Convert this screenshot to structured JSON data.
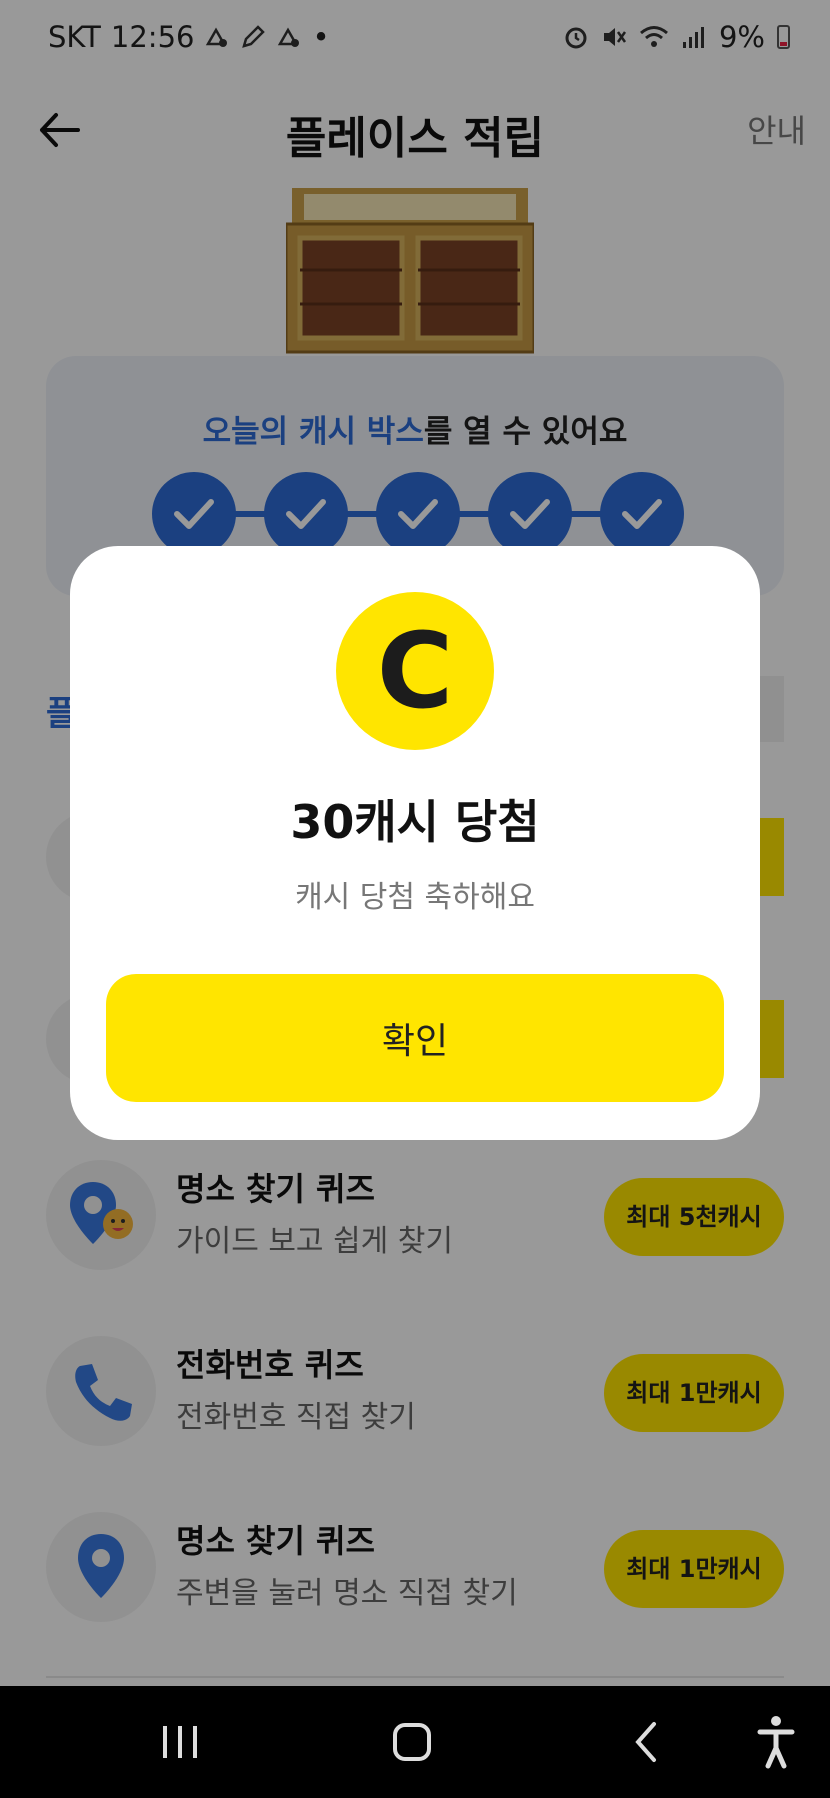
{
  "status_bar": {
    "carrier": "SKT",
    "time": "12:56",
    "dot": "•",
    "battery": "9%"
  },
  "header": {
    "title": "플레이스 적립",
    "guide_label": "안내"
  },
  "today_box": {
    "heading_highlight": "오늘의 캐시 박스",
    "heading_rest": "를 열 수 있어요",
    "completed_checks": 5,
    "total_checks": 5
  },
  "section_hint": "플",
  "quiz_items": [
    {
      "title": "명소 찾기 퀴즈",
      "desc": "가이드 보고 쉽게 찾기",
      "badge": "최대 5천캐시",
      "icon": "location-smile-icon"
    },
    {
      "title": "전화번호 퀴즈",
      "desc": "전화번호 직접 찾기",
      "badge": "최대 1만캐시",
      "icon": "phone-icon"
    },
    {
      "title": "명소 찾기 퀴즈",
      "desc": "주변을 눌러 명소 직접 찾기",
      "badge": "최대 1만캐시",
      "icon": "location-pin-icon"
    }
  ],
  "modal": {
    "coin_letter": "C",
    "title": "30캐시 당첨",
    "subtitle": "캐시 당첨 축하해요",
    "confirm_label": "확인"
  },
  "colors": {
    "accent_blue": "#2d6bd6",
    "accent_yellow": "#ffe500"
  }
}
